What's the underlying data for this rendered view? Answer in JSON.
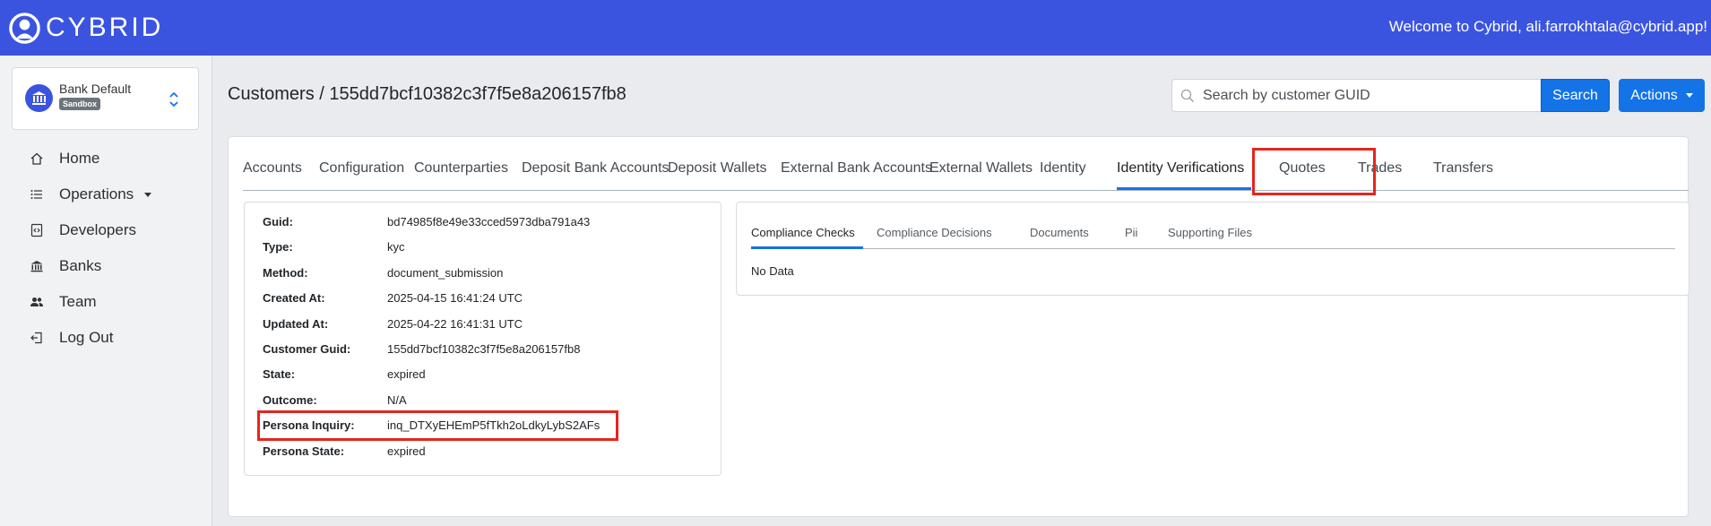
{
  "app": {
    "brand": "CYBRID",
    "welcome": "Welcome to Cybrid, ali.farrokhtala@cybrid.app!",
    "accent_color": "#3b54e0"
  },
  "sidebar": {
    "bank": {
      "name": "Bank Default",
      "badge": "Sandbox"
    },
    "items": [
      {
        "label": "Home",
        "icon": "home-icon"
      },
      {
        "label": "Operations",
        "icon": "list-icon"
      },
      {
        "label": "Developers",
        "icon": "code-file-icon"
      },
      {
        "label": "Banks",
        "icon": "bank-icon"
      },
      {
        "label": "Team",
        "icon": "people-icon"
      },
      {
        "label": "Log Out",
        "icon": "logout-icon"
      }
    ]
  },
  "header": {
    "breadcrumb": "Customers / 155dd7bcf10382c3f7f5e8a206157fb8",
    "search_placeholder": "Search by customer GUID",
    "search_label": "Search",
    "actions_label": "Actions"
  },
  "tabs": [
    "Accounts",
    "Configuration",
    "Counterparties",
    "Deposit Bank Accounts",
    "Deposit Wallets",
    "External Bank Accounts",
    "External Wallets",
    "Identity",
    "Identity Verifications",
    "Quotes",
    "Trades",
    "Transfers"
  ],
  "active_tab": "Identity Verifications",
  "details": [
    {
      "key": "Guid:",
      "value": "bd74985f8e49e33cced5973dba791a43"
    },
    {
      "key": "Type:",
      "value": "kyc"
    },
    {
      "key": "Method:",
      "value": "document_submission"
    },
    {
      "key": "Created At:",
      "value": "2025-04-15 16:41:24 UTC"
    },
    {
      "key": "Updated At:",
      "value": "2025-04-22 16:41:31 UTC"
    },
    {
      "key": "Customer Guid:",
      "value": "155dd7bcf10382c3f7f5e8a206157fb8"
    },
    {
      "key": "State:",
      "value": "expired"
    },
    {
      "key": "Outcome:",
      "value": "N/A"
    },
    {
      "key": "Persona Inquiry:",
      "value": "inq_DTXyEHEmP5fTkh2oLdkyLybS2AFs"
    },
    {
      "key": "Persona State:",
      "value": "expired"
    }
  ],
  "subtabs": [
    "Compliance Checks",
    "Compliance Decisions",
    "Documents",
    "Pii",
    "Supporting Files"
  ],
  "active_subtab": "Compliance Checks",
  "empty_message": "No Data",
  "highlight_color": "#e4261f"
}
